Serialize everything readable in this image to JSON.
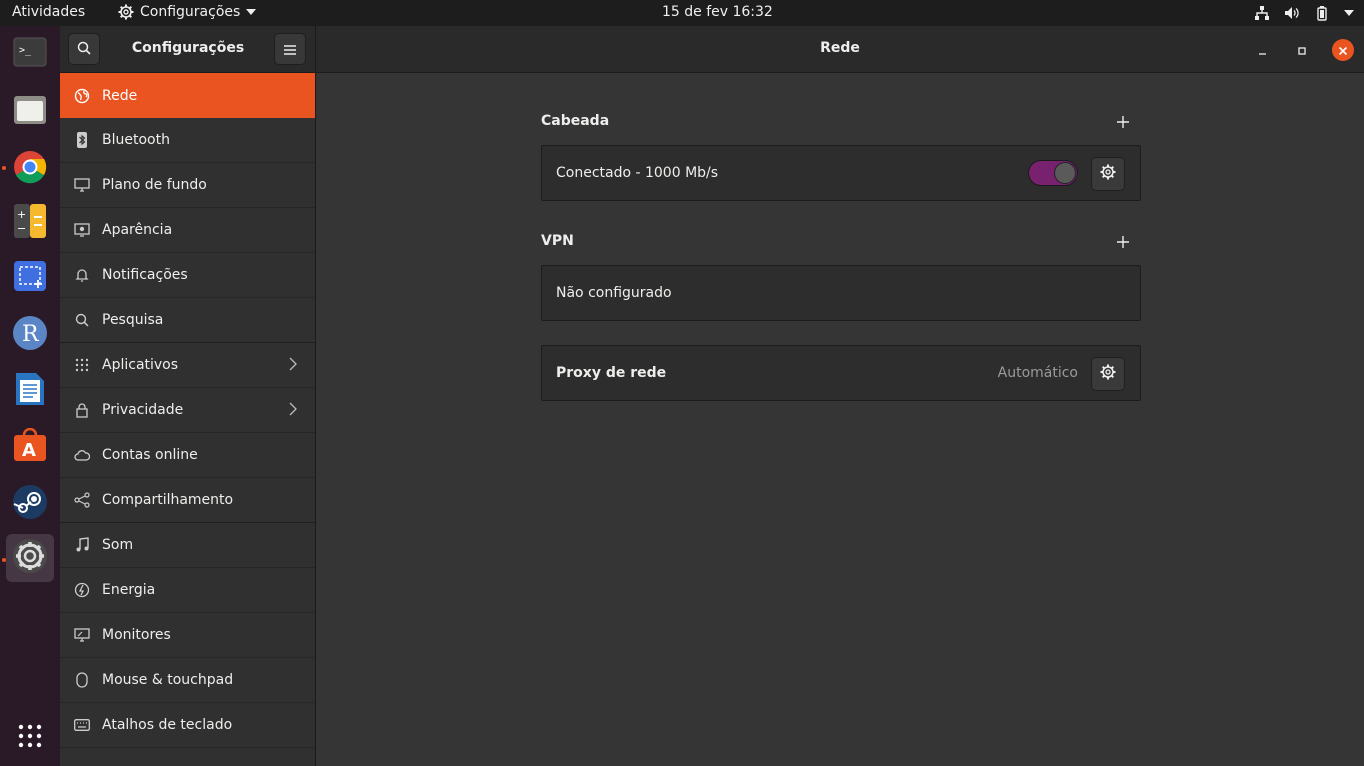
{
  "topbar": {
    "activities": "Atividades",
    "app_menu": "Configurações",
    "clock": "15 de fev  16:32"
  },
  "sidebar": {
    "title": "Configurações",
    "items": [
      {
        "label": "Rede",
        "icon": "network-icon"
      },
      {
        "label": "Bluetooth",
        "icon": "bluetooth-icon"
      },
      {
        "label": "Plano de fundo",
        "icon": "background-icon"
      },
      {
        "label": "Aparência",
        "icon": "appearance-icon"
      },
      {
        "label": "Notificações",
        "icon": "bell-icon"
      },
      {
        "label": "Pesquisa",
        "icon": "search-icon"
      },
      {
        "label": "Aplicativos",
        "icon": "apps-grid-icon"
      },
      {
        "label": "Privacidade",
        "icon": "lock-icon"
      },
      {
        "label": "Contas online",
        "icon": "cloud-icon"
      },
      {
        "label": "Compartilhamento",
        "icon": "share-icon"
      },
      {
        "label": "Som",
        "icon": "music-note-icon"
      },
      {
        "label": "Energia",
        "icon": "power-icon"
      },
      {
        "label": "Monitores",
        "icon": "monitor-icon"
      },
      {
        "label": "Mouse & touchpad",
        "icon": "mouse-icon"
      },
      {
        "label": "Atalhos de teclado",
        "icon": "keyboard-icon"
      }
    ]
  },
  "main": {
    "title": "Rede",
    "wired": {
      "title": "Cabeada",
      "status": "Conectado - 1000 Mb/s",
      "enabled": true
    },
    "vpn": {
      "title": "VPN",
      "status": "Não configurado"
    },
    "proxy": {
      "label": "Proxy de rede",
      "value": "Automático"
    }
  },
  "colors": {
    "accent": "#e95420",
    "toggle_on": "#77216f",
    "dock_bg": "#2a1a28"
  }
}
